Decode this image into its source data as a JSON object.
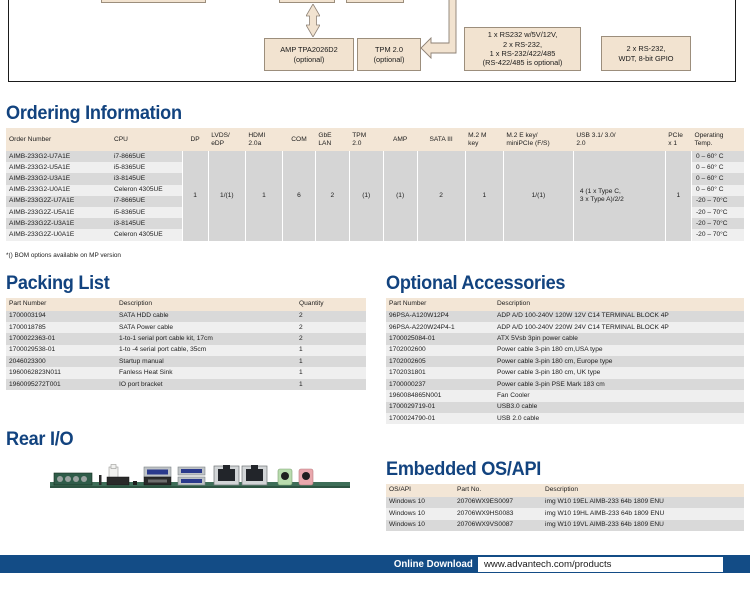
{
  "diagram": {
    "boxes": [
      {
        "id": "amp",
        "text": "AMP TPA2026D2\n(optional)"
      },
      {
        "id": "tpm",
        "text": "TPM 2.0\n(optional)"
      },
      {
        "id": "serial",
        "text": "1 x RS232 w/5V/12V,\n2 x RS-232,\n1 x RS-232/422/485\n(RS-422/485 is optional)"
      },
      {
        "id": "gpio",
        "text": "2 x RS-232,\nWDT, 8-bit GPIO"
      }
    ]
  },
  "sections": {
    "ordering": "Ordering Information",
    "packing": "Packing List",
    "optional": "Optional Accessories",
    "rear_io": "Rear I/O",
    "embedded_os": "Embedded OS/API"
  },
  "ordering": {
    "headers": [
      "Order Number",
      "CPU",
      "DP",
      "LVDS/\neDP",
      "HDMI\n2.0a",
      "COM",
      "GbE\nLAN",
      "TPM\n2.0",
      "AMP",
      "SATA III",
      "M.2 M\nkey",
      "M.2 E key/\nminiPCIe (F/S)",
      "USB 3.1/ 3.0/\n2.0",
      "PCIe\nx 1",
      "Operating\nTemp."
    ],
    "rows": [
      {
        "order_number": "AIMB-233G2-U7A1E",
        "cpu": "i7-8665UE",
        "temp": "0 – 60° C"
      },
      {
        "order_number": "AIMB-233G2-U5A1E",
        "cpu": "i5-8365UE",
        "temp": "0 – 60° C"
      },
      {
        "order_number": "AIMB-233G2-U3A1E",
        "cpu": "i3-8145UE",
        "temp": "0 – 60° C"
      },
      {
        "order_number": "AIMB-233G2-U0A1E",
        "cpu": "Celeron 4305UE",
        "temp": "0 – 60° C"
      },
      {
        "order_number": "AIMB-233G2Z-U7A1E",
        "cpu": "i7-8665UE",
        "temp": "-20 – 70°C"
      },
      {
        "order_number": "AIMB-233G2Z-U5A1E",
        "cpu": "i5-8365UE",
        "temp": "-20 – 70°C"
      },
      {
        "order_number": "AIMB-233G2Z-U3A1E",
        "cpu": "i3-8145UE",
        "temp": "-20 – 70°C"
      },
      {
        "order_number": "AIMB-233G2Z-U0A1E",
        "cpu": "Celeron 4305UE",
        "temp": "-20 – 70°C"
      }
    ],
    "spec_values": {
      "dp": "1",
      "lvds_edp": "1/(1)",
      "hdmi": "1",
      "com": "6",
      "gbe_lan": "2",
      "tpm": "(1)",
      "amp": "(1)",
      "sata3": "2",
      "m2_m_key": "1",
      "m2_e_key": "1/(1)",
      "usb": "4 (1 x Type C,\n3 x Type A)/2/2",
      "pcie": "1"
    },
    "footnote": "*() BOM options available on MP version"
  },
  "packing": {
    "headers": [
      "Part Number",
      "Description",
      "Quantity"
    ],
    "rows": [
      {
        "part": "1700003194",
        "desc": "SATA HDD cable",
        "qty": "2"
      },
      {
        "part": "1700018785",
        "desc": "SATA Power cable",
        "qty": "2"
      },
      {
        "part": "1700022363-01",
        "desc": "1-to-1 serial port cable kit, 17cm",
        "qty": "2"
      },
      {
        "part": "1700029538-01",
        "desc": "1-to -4 serial port cable, 35cm",
        "qty": "1"
      },
      {
        "part": "2046023300",
        "desc": "Startup manual",
        "qty": "1"
      },
      {
        "part": "1960062823N011",
        "desc": "Fanless Heat Sink",
        "qty": "1"
      },
      {
        "part": "1960095272T001",
        "desc": "IO port bracket",
        "qty": "1"
      }
    ]
  },
  "optional": {
    "headers": [
      "Part Number",
      "Description"
    ],
    "rows": [
      {
        "part": "96PSA-A120W12P4",
        "desc": "ADP A/D 100-240V 120W 12V C14 TERMINAL BLOCK 4P"
      },
      {
        "part": "96PSA-A220W24P4-1",
        "desc": "ADP A/D 100-240V 220W 24V C14 TERMINAL BLOCK 4P"
      },
      {
        "part": "1700025084-01",
        "desc": "ATX 5Vsb 3pin power cable"
      },
      {
        "part": "1702002600",
        "desc": "Power cable 3-pin 180 cm,USA type"
      },
      {
        "part": "1702002605",
        "desc": "Power cable 3-pin 180 cm, Europe type"
      },
      {
        "part": "1702031801",
        "desc": "Power cable 3-pin 180 cm, UK type"
      },
      {
        "part": "1700000237",
        "desc": "Power cable 3-pin PSE Mark 183 cm"
      },
      {
        "part": "1960084865N001",
        "desc": "Fan Cooler"
      },
      {
        "part": "1700029719-01",
        "desc": "USB3.0 cable"
      },
      {
        "part": "1700024790-01",
        "desc": "USB 2.0 cable"
      }
    ]
  },
  "embedded_os": {
    "headers": [
      "OS/API",
      "Part No.",
      "Description"
    ],
    "rows": [
      {
        "os": "Windows 10",
        "part": "20706WX9ES0097",
        "desc": "img W10 19EL AIMB-233 64b 1809 ENU"
      },
      {
        "os": "Windows 10",
        "part": "20706WX9HS0083",
        "desc": "img W10 19HL AIMB-233 64b 1809 ENU"
      },
      {
        "os": "Windows 10",
        "part": "20706WX9VS0087",
        "desc": "img W10 19VL AIMB-233 64b 1809 ENU"
      }
    ]
  },
  "footer": {
    "label": "Online Download",
    "url": "www.advantech.com/products"
  },
  "colors": {
    "heading_blue": "#12437f",
    "footer_blue": "#134c86",
    "table_header_beige": "#f3e6d6",
    "row_dark": "#d9d9d9",
    "row_light": "#efefef",
    "diagram_box": "#f2e3d0"
  }
}
